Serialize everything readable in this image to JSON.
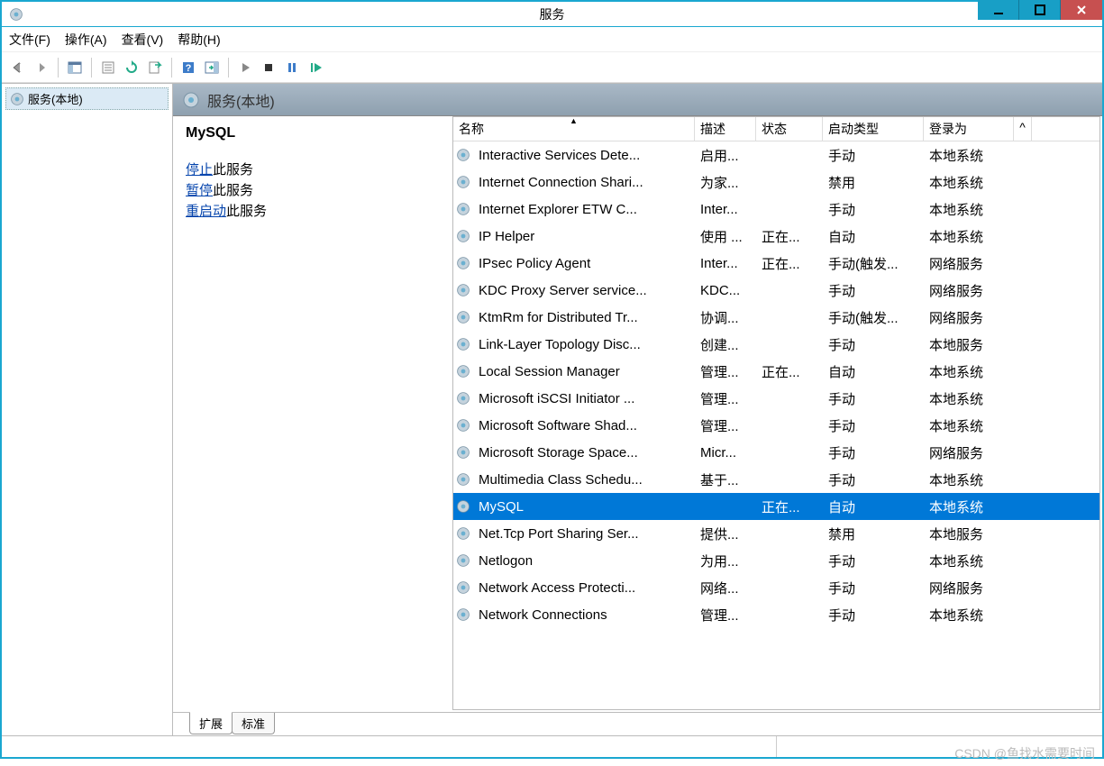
{
  "window": {
    "title": "服务"
  },
  "menu": {
    "file": "文件(F)",
    "action": "操作(A)",
    "view": "查看(V)",
    "help": "帮助(H)"
  },
  "tree": {
    "root": "服务(本地)"
  },
  "pane": {
    "header": "服务(本地)",
    "detail_title": "MySQL",
    "stop_link": "停止",
    "stop_suffix": "此服务",
    "pause_link": "暂停",
    "pause_suffix": "此服务",
    "restart_link": "重启动",
    "restart_suffix": "此服务"
  },
  "columns": {
    "name": "名称",
    "desc": "描述",
    "status": "状态",
    "startup": "启动类型",
    "logon": "登录为",
    "scroll": "^"
  },
  "tabs": {
    "extended": "扩展",
    "standard": "标准"
  },
  "services": [
    {
      "name": "Interactive Services Dete...",
      "desc": "启用...",
      "status": "",
      "startup": "手动",
      "logon": "本地系统",
      "selected": false
    },
    {
      "name": "Internet Connection Shari...",
      "desc": "为家...",
      "status": "",
      "startup": "禁用",
      "logon": "本地系统",
      "selected": false
    },
    {
      "name": "Internet Explorer ETW C...",
      "desc": "Inter...",
      "status": "",
      "startup": "手动",
      "logon": "本地系统",
      "selected": false
    },
    {
      "name": "IP Helper",
      "desc": "使用 ...",
      "status": "正在...",
      "startup": "自动",
      "logon": "本地系统",
      "selected": false
    },
    {
      "name": "IPsec Policy Agent",
      "desc": "Inter...",
      "status": "正在...",
      "startup": "手动(触发...",
      "logon": "网络服务",
      "selected": false
    },
    {
      "name": "KDC Proxy Server service...",
      "desc": "KDC...",
      "status": "",
      "startup": "手动",
      "logon": "网络服务",
      "selected": false
    },
    {
      "name": "KtmRm for Distributed Tr...",
      "desc": "协调...",
      "status": "",
      "startup": "手动(触发...",
      "logon": "网络服务",
      "selected": false
    },
    {
      "name": "Link-Layer Topology Disc...",
      "desc": "创建...",
      "status": "",
      "startup": "手动",
      "logon": "本地服务",
      "selected": false
    },
    {
      "name": "Local Session Manager",
      "desc": "管理...",
      "status": "正在...",
      "startup": "自动",
      "logon": "本地系统",
      "selected": false
    },
    {
      "name": "Microsoft iSCSI Initiator ...",
      "desc": "管理...",
      "status": "",
      "startup": "手动",
      "logon": "本地系统",
      "selected": false
    },
    {
      "name": "Microsoft Software Shad...",
      "desc": "管理...",
      "status": "",
      "startup": "手动",
      "logon": "本地系统",
      "selected": false
    },
    {
      "name": "Microsoft Storage Space...",
      "desc": "Micr...",
      "status": "",
      "startup": "手动",
      "logon": "网络服务",
      "selected": false
    },
    {
      "name": "Multimedia Class Schedu...",
      "desc": "基于...",
      "status": "",
      "startup": "手动",
      "logon": "本地系统",
      "selected": false
    },
    {
      "name": "MySQL",
      "desc": "",
      "status": "正在...",
      "startup": "自动",
      "logon": "本地系统",
      "selected": true
    },
    {
      "name": "Net.Tcp Port Sharing Ser...",
      "desc": "提供...",
      "status": "",
      "startup": "禁用",
      "logon": "本地服务",
      "selected": false
    },
    {
      "name": "Netlogon",
      "desc": "为用...",
      "status": "",
      "startup": "手动",
      "logon": "本地系统",
      "selected": false
    },
    {
      "name": "Network Access Protecti...",
      "desc": "网络...",
      "status": "",
      "startup": "手动",
      "logon": "网络服务",
      "selected": false
    },
    {
      "name": "Network Connections",
      "desc": "管理...",
      "status": "",
      "startup": "手动",
      "logon": "本地系统",
      "selected": false
    }
  ],
  "watermark": "CSDN @鱼找水需要时间"
}
